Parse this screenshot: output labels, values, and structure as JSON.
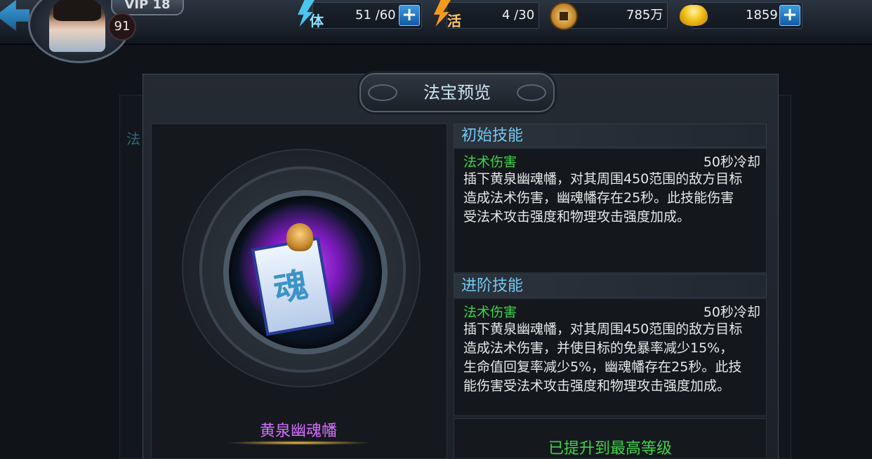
{
  "topbar": {
    "vip_label": "VIP 18",
    "level": "91",
    "stamina": {
      "icon": "lightning-icon",
      "label": "体",
      "value": "51 /60"
    },
    "vitality": {
      "icon": "lightning-icon",
      "label": "活",
      "value": "4 /30"
    },
    "coins": {
      "icon": "copper-coin-icon",
      "value": "785万"
    },
    "gold": {
      "icon": "gold-ingot-icon",
      "value": "1859"
    },
    "plus_symbol": "+"
  },
  "background": {
    "tab_char": "法"
  },
  "dialog": {
    "title": "法宝预览",
    "artifact": {
      "name": "黄泉幽魂幡",
      "glyph": "魂"
    },
    "initial_skill": {
      "header": "初始技能",
      "type": "法术伤害",
      "cooldown": "50秒冷却",
      "description": "插下黄泉幽魂幡，对其周围450范围的敌方目标\n造成法术伤害，幽魂幡存在25秒。此技能伤害\n受法术攻击强度和物理攻击强度加成。"
    },
    "advanced_skill": {
      "header": "进阶技能",
      "type": "法术伤害",
      "cooldown": "50秒冷却",
      "description": "插下黄泉幽魂幡，对其周围450范围的敌方目标\n造成法术伤害，并使目标的免暴率减少15%，\n生命值回复率减少5%，幽魂幡存在25秒。此技\n能伤害受法术攻击强度和物理攻击强度加成。"
    },
    "max_level_text": "已提升到最高等级"
  },
  "colors": {
    "skill_type": "#3ed24a",
    "section_header": "#74c8f2",
    "artifact_name": "#d470ff",
    "stamina_bolt": "#4cc6f0",
    "vitality_bolt": "#f39a1c"
  }
}
